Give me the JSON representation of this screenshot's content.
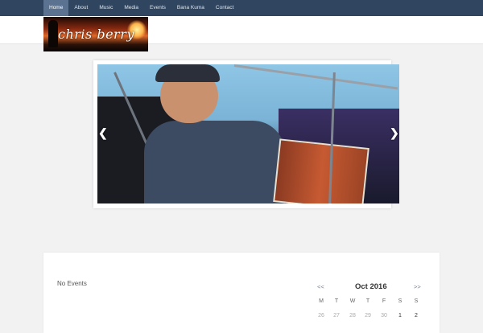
{
  "nav": {
    "items": [
      {
        "label": "Home",
        "active": true
      },
      {
        "label": "About",
        "active": false
      },
      {
        "label": "Music",
        "active": false
      },
      {
        "label": "Media",
        "active": false
      },
      {
        "label": "Events",
        "active": false
      },
      {
        "label": "Bana Kuma",
        "active": false
      },
      {
        "label": "Contact",
        "active": false
      }
    ],
    "colors": {
      "bar": "#2f4560",
      "active": "#5b7390"
    }
  },
  "header": {
    "logo_text": "chris berry"
  },
  "slider": {
    "prev_icon": "chevron-left-icon",
    "next_icon": "chevron-right-icon",
    "prev_glyph": "❮",
    "next_glyph": "❯"
  },
  "events": {
    "empty_text": "No Events",
    "calendar": {
      "month_label": "Oct 2016",
      "prev_label": "<<",
      "next_label": ">>",
      "weekdays": [
        "M",
        "T",
        "W",
        "T",
        "F",
        "S",
        "S"
      ],
      "first_row": [
        {
          "day": "26",
          "muted": true
        },
        {
          "day": "27",
          "muted": true
        },
        {
          "day": "28",
          "muted": true
        },
        {
          "day": "29",
          "muted": true
        },
        {
          "day": "30",
          "muted": true
        },
        {
          "day": "1",
          "muted": false
        },
        {
          "day": "2",
          "muted": false
        }
      ]
    }
  }
}
